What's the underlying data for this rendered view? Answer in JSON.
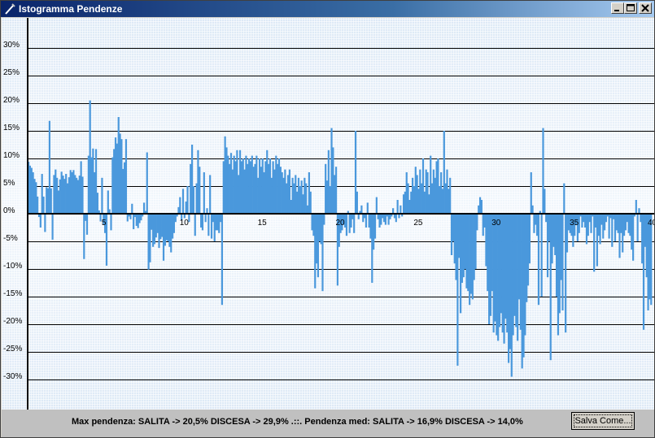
{
  "window": {
    "title": "Istogramma Pendenze",
    "icon": "tool-icon"
  },
  "titlebar_buttons": [
    "minimize",
    "maximize",
    "close"
  ],
  "colors": {
    "bar": "#4a98dc",
    "titlebar_start": "#0a246a",
    "titlebar_end": "#a6caf0"
  },
  "chart_data": {
    "type": "bar",
    "title": "",
    "xlabel": "",
    "ylabel": "",
    "ylim": [
      -35,
      35
    ],
    "xlim": [
      0,
      40
    ],
    "x_ticks": [
      "5",
      "10",
      "15",
      "20",
      "25",
      "30",
      "35",
      "40"
    ],
    "y_ticks": [
      "30%",
      "25%",
      "20%",
      "15%",
      "10%",
      "5%",
      "0%",
      "-5%",
      "-10%",
      "-15%",
      "-20%",
      "-25%",
      "-30%"
    ],
    "grid": true,
    "series": [
      {
        "values": [
          9.4,
          8.7,
          8.3,
          7.5,
          6.3,
          5.7,
          3.1,
          -0.6,
          -2.5,
          7.2,
          3.1,
          -3.3,
          4.8,
          4.6,
          16.8,
          4.6,
          -4.7,
          7.0,
          8.0,
          6.5,
          4.2,
          6.2,
          7.6,
          6.9,
          6.3,
          7.2,
          5.5,
          6.6,
          7.9,
          7.5,
          7.9,
          7.0,
          6.5,
          6.1,
          6.9,
          9.5,
          6.7,
          -8.2,
          -1.3,
          -3.8,
          10.5,
          20.5,
          10.2,
          11.8,
          7.5,
          11.7,
          3.8,
          0.6,
          -1.4,
          6.5,
          -1.9,
          -3.5,
          -9.4,
          4.2,
          0.8,
          -3.0,
          10.2,
          11.7,
          13.8,
          12.7,
          17.5,
          14.5,
          13.5,
          8.1,
          9.3,
          13.5,
          -1.4,
          -0.5,
          -1.0,
          1.8,
          -2.8,
          -0.6,
          -2.2,
          -2.6,
          -1.7,
          -1.2,
          -0.5,
          2.0,
          0.5,
          11.1,
          -10.1,
          -8.8,
          -2.9,
          -6.0,
          -5.5,
          -4.3,
          -3.5,
          -6.2,
          -4.6,
          -4.2,
          -8.5,
          -5.8,
          -4.8,
          -5.0,
          -6.0,
          -7.0,
          -4.5,
          -3.5,
          -1.5,
          -0.5,
          1.2,
          3.0,
          -1.2,
          4.5,
          -0.8,
          2.2,
          5.0,
          -1.5,
          9.0,
          12.5,
          5.0,
          -4.0,
          5.5,
          11.5,
          8.5,
          -2.5,
          -3.0,
          7.5,
          -1.5,
          1.0,
          -4.0,
          7.0,
          -4.5,
          -1.5,
          -5.0,
          -3.0,
          -3.0,
          -3.5,
          -1.5,
          -16.5,
          9.5,
          14.0,
          12.0,
          10.5,
          9.0,
          11.0,
          8.0,
          10.5,
          9.5,
          11.5,
          7.0,
          11.5,
          9.5,
          10.0,
          8.0,
          10.5,
          9.0,
          10.0,
          9.5,
          10.5,
          8.5,
          9.0,
          10.5,
          6.5,
          10.0,
          8.5,
          10.0,
          7.5,
          9.5,
          11.5,
          9.0,
          10.0,
          6.5,
          9.5,
          8.0,
          10.5,
          9.0,
          10.0,
          8.5,
          7.5,
          6.5,
          8.0,
          5.5,
          7.0,
          8.0,
          2.5,
          6.5,
          5.5,
          7.0,
          4.0,
          6.5,
          5.0,
          6.0,
          3.5,
          6.5,
          5.5,
          1.5,
          7.5,
          4.0,
          -3.0,
          -4.0,
          -13.5,
          -9.0,
          -11.5,
          -5.0,
          -5.5,
          -14.0,
          -2.0,
          9.0,
          6.0,
          11.5,
          5.0,
          15.5,
          12.0,
          7.0,
          8.5,
          -13.0,
          -6.0,
          -3.5,
          -3.0,
          -2.0,
          -2.5,
          -4.0,
          0.5,
          -3.5,
          -2.5,
          -1.0,
          -3.5,
          15.0,
          4.0,
          -1.0,
          0.5,
          1.5,
          -1.5,
          -0.8,
          -2.5,
          2.0,
          -2.5,
          -4.5,
          -12.5,
          -6.5,
          -4.5,
          3.0,
          -1.0,
          -2.5,
          -2.0,
          -0.8,
          -1.5,
          -2.0,
          -0.5,
          -2.0,
          -1.0,
          -0.5,
          1.0,
          -0.8,
          -1.5,
          2.5,
          -0.8,
          1.5,
          -0.5,
          3.5,
          4.0,
          7.5,
          5.5,
          2.5,
          4.0,
          6.5,
          5.0,
          8.5,
          7.0,
          4.5,
          8.0,
          5.5,
          10.0,
          4.0,
          8.0,
          7.5,
          3.5,
          10.5,
          5.5,
          8.0,
          6.5,
          9.5,
          10.0,
          5.0,
          7.5,
          4.5,
          15.0,
          5.5,
          8.0,
          4.5,
          6.5,
          -7.5,
          -5.0,
          -9.0,
          -12.0,
          -27.5,
          -8.0,
          -18.0,
          -12.5,
          -11.5,
          -10.0,
          -13.5,
          -14.0,
          -16.5,
          -14.5,
          -15.5,
          -12.0,
          -10.0,
          -3.0,
          1.5,
          3.0,
          2.5,
          -4.0,
          -2.5,
          -9.5,
          -14.0,
          -20.0,
          -18.5,
          -14.0,
          -21.5,
          -19.5,
          -22.0,
          -23.0,
          -20.5,
          -18.0,
          -21.5,
          -23.5,
          -19.0,
          -21.5,
          -27.0,
          -24.5,
          -29.5,
          -22.0,
          -18.5,
          -20.5,
          -23.0,
          -15.5,
          -21.0,
          -28.0,
          -26.0,
          -22.0,
          -16.0,
          -13.0,
          -9.0,
          7.5,
          1.5,
          -3.5,
          -2.0,
          -4.0,
          -16.5,
          0.5,
          -15.0,
          15.5,
          4.5,
          -1.5,
          -11.5,
          -5.0,
          -26.5,
          -9.0,
          -6.0,
          -7.5,
          -15.0,
          -22.0,
          -18.0,
          -12.0,
          -17.5,
          5.5,
          -21.5,
          -7.0,
          -3.0,
          -3.5,
          -4.0,
          -6.0,
          -4.0,
          -2.0,
          -5.0,
          -3.5,
          -0.5,
          -2.5,
          -1.5,
          -2.5,
          -5.5,
          -4.0,
          -1.5,
          -3.5,
          -0.5,
          -10.5,
          -2.5,
          -9.5,
          -4.0,
          -5.5,
          -2.0,
          -4.5,
          -3.0,
          -1.5,
          -0.5,
          -4.5,
          -0.8,
          -6.0,
          -1.0,
          -5.0,
          -3.0,
          -3.5,
          -8.0,
          -3.5,
          -7.0,
          -4.0,
          -3.0,
          -1.5,
          -3.5,
          -4.0,
          -6.5,
          -8.5,
          -0.5,
          2.5,
          -5.0,
          1.0,
          -1.5,
          -9.0,
          -21.0,
          -6.0,
          -11.5,
          -17.5,
          -15.5,
          -16.5
        ]
      }
    ]
  },
  "status": {
    "text": "Max pendenza: SALITA -> 20,5% DISCESA -> 29,9% .::. Pendenza med: SALITA -> 16,9% DISCESA -> 14,0%"
  },
  "buttons": {
    "save_label": "Salva Come..."
  }
}
